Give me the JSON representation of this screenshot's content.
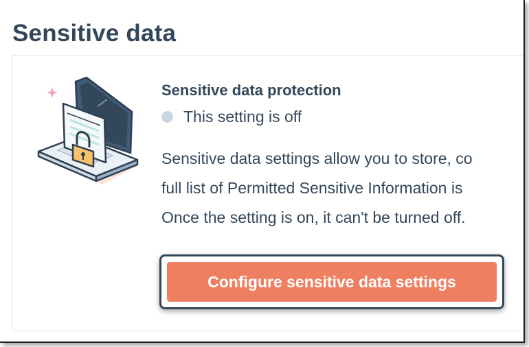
{
  "page": {
    "title": "Sensitive data"
  },
  "card": {
    "title": "Sensitive data protection",
    "status_text": "This setting is off",
    "description_lines": [
      "Sensitive data settings allow you to store, co",
      "full list of Permitted Sensitive Information is",
      "Once the setting is on, it can't be turned off."
    ],
    "cta_label": "Configure sensitive data settings"
  },
  "colors": {
    "text": "#33475b",
    "status_dot": "#cbd6e2",
    "cta_background": "#ef7f61",
    "cta_text": "#ffffff",
    "card_border": "#dfe3eb"
  },
  "icons": {
    "illustration": "laptop-with-padlock-illustration"
  }
}
